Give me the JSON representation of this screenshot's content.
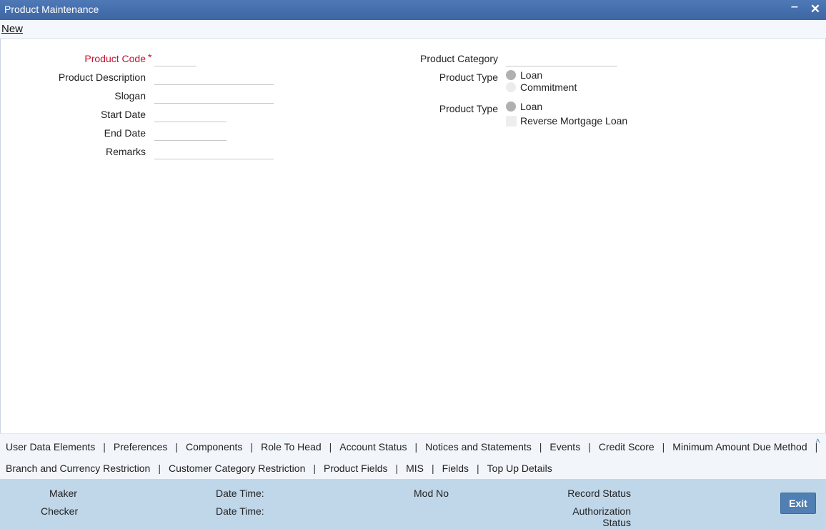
{
  "window": {
    "title": "Product Maintenance"
  },
  "toolbar": {
    "new_label": "New"
  },
  "form": {
    "product_code": {
      "label": "Product Code",
      "required_mark": "*",
      "value": ""
    },
    "product_description": {
      "label": "Product Description",
      "value": ""
    },
    "slogan": {
      "label": "Slogan",
      "value": ""
    },
    "start_date": {
      "label": "Start Date",
      "value": ""
    },
    "end_date": {
      "label": "End Date",
      "value": ""
    },
    "remarks": {
      "label": "Remarks",
      "value": ""
    },
    "product_category": {
      "label": "Product Category",
      "value": ""
    },
    "product_type_1": {
      "label": "Product Type",
      "options": [
        "Loan",
        "Commitment"
      ]
    },
    "product_type_2": {
      "label": "Product Type",
      "option": "Loan",
      "checkbox_label": "Reverse Mortgage Loan"
    }
  },
  "tabs": {
    "row1": [
      "User Data Elements",
      "Preferences",
      "Components",
      "Role To Head",
      "Account Status",
      "Notices and Statements",
      "Events",
      "Credit Score",
      "Minimum Amount Due Method"
    ],
    "row2": [
      "Branch and Currency Restriction",
      "Customer Category Restriction",
      "Product Fields",
      "MIS",
      "Fields",
      "Top Up Details"
    ],
    "separator": "|"
  },
  "footer": {
    "maker": "Maker",
    "checker": "Checker",
    "date_time_1": "Date Time:",
    "date_time_2": "Date Time:",
    "mod_no": "Mod No",
    "record_status": "Record Status",
    "authorization_status_1": "Authorization",
    "authorization_status_2": "Status",
    "exit_label": "Exit"
  },
  "colors": {
    "title_bar": "#3d66a3",
    "required": "#c8102e",
    "footer": "#c0d7ea",
    "exit_button": "#4f7fb3"
  }
}
